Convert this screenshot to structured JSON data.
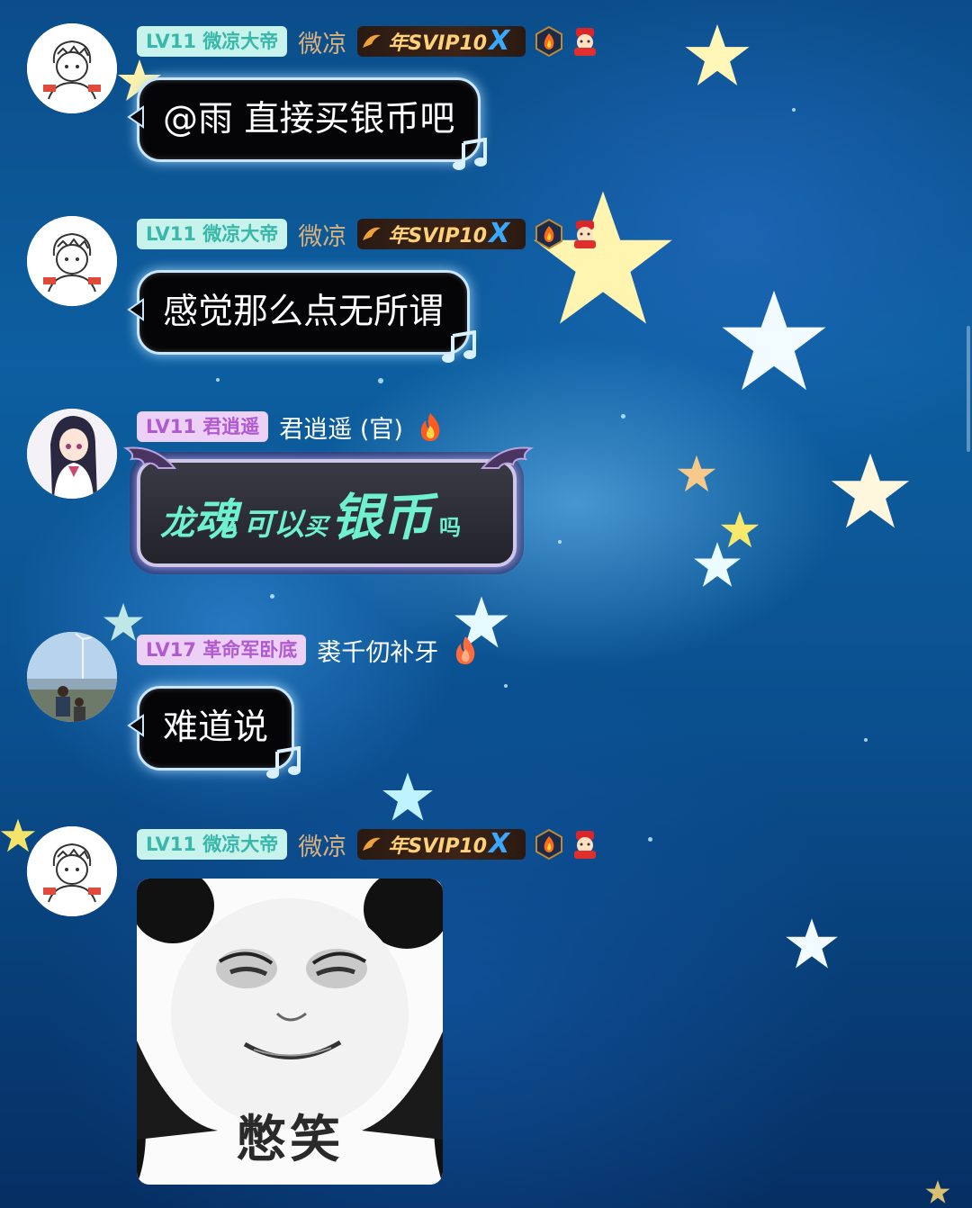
{
  "messages": [
    {
      "level": "LV11",
      "group": "微凉大帝",
      "username": "微凉",
      "badge_prefix": "年",
      "badge_text": "SVIP10",
      "badge_suffix": "X",
      "text": "@雨 直接买银币吧"
    },
    {
      "level": "LV11",
      "group": "微凉大帝",
      "username": "微凉",
      "badge_prefix": "年",
      "badge_text": "SVIP10",
      "badge_suffix": "X",
      "text": "感觉那么点无所谓"
    },
    {
      "level": "LV11",
      "group": "君逍遥",
      "username": "君逍遥 (官)",
      "text_parts": [
        "龙",
        "魂",
        "可以",
        "买",
        "银币",
        "吗"
      ]
    },
    {
      "level": "LV17",
      "group": "革命军卧底",
      "username": "裘千仞补牙",
      "text": "难道说"
    },
    {
      "level": "LV11",
      "group": "微凉大帝",
      "username": "微凉",
      "badge_prefix": "年",
      "badge_text": "SVIP10",
      "badge_suffix": "X",
      "sticker_caption": "憋笑"
    }
  ],
  "colors": {
    "level_teal_bg": "#c8f2ec",
    "level_teal_text": "#37b8a9",
    "level_purple_bg": "#ecd0f6",
    "level_purple_text": "#b05ad0",
    "username_gold": "#d9b17c",
    "ornate_text": "#6ff0cf"
  },
  "icons": [
    "avatar-boy-sketch",
    "avatar-anime-girl",
    "avatar-photo-seaside",
    "svip-wing-icon",
    "flame-medal-icon",
    "fortune-god-icon",
    "fire-icon",
    "music-note-icon",
    "bat-wing-icon"
  ]
}
